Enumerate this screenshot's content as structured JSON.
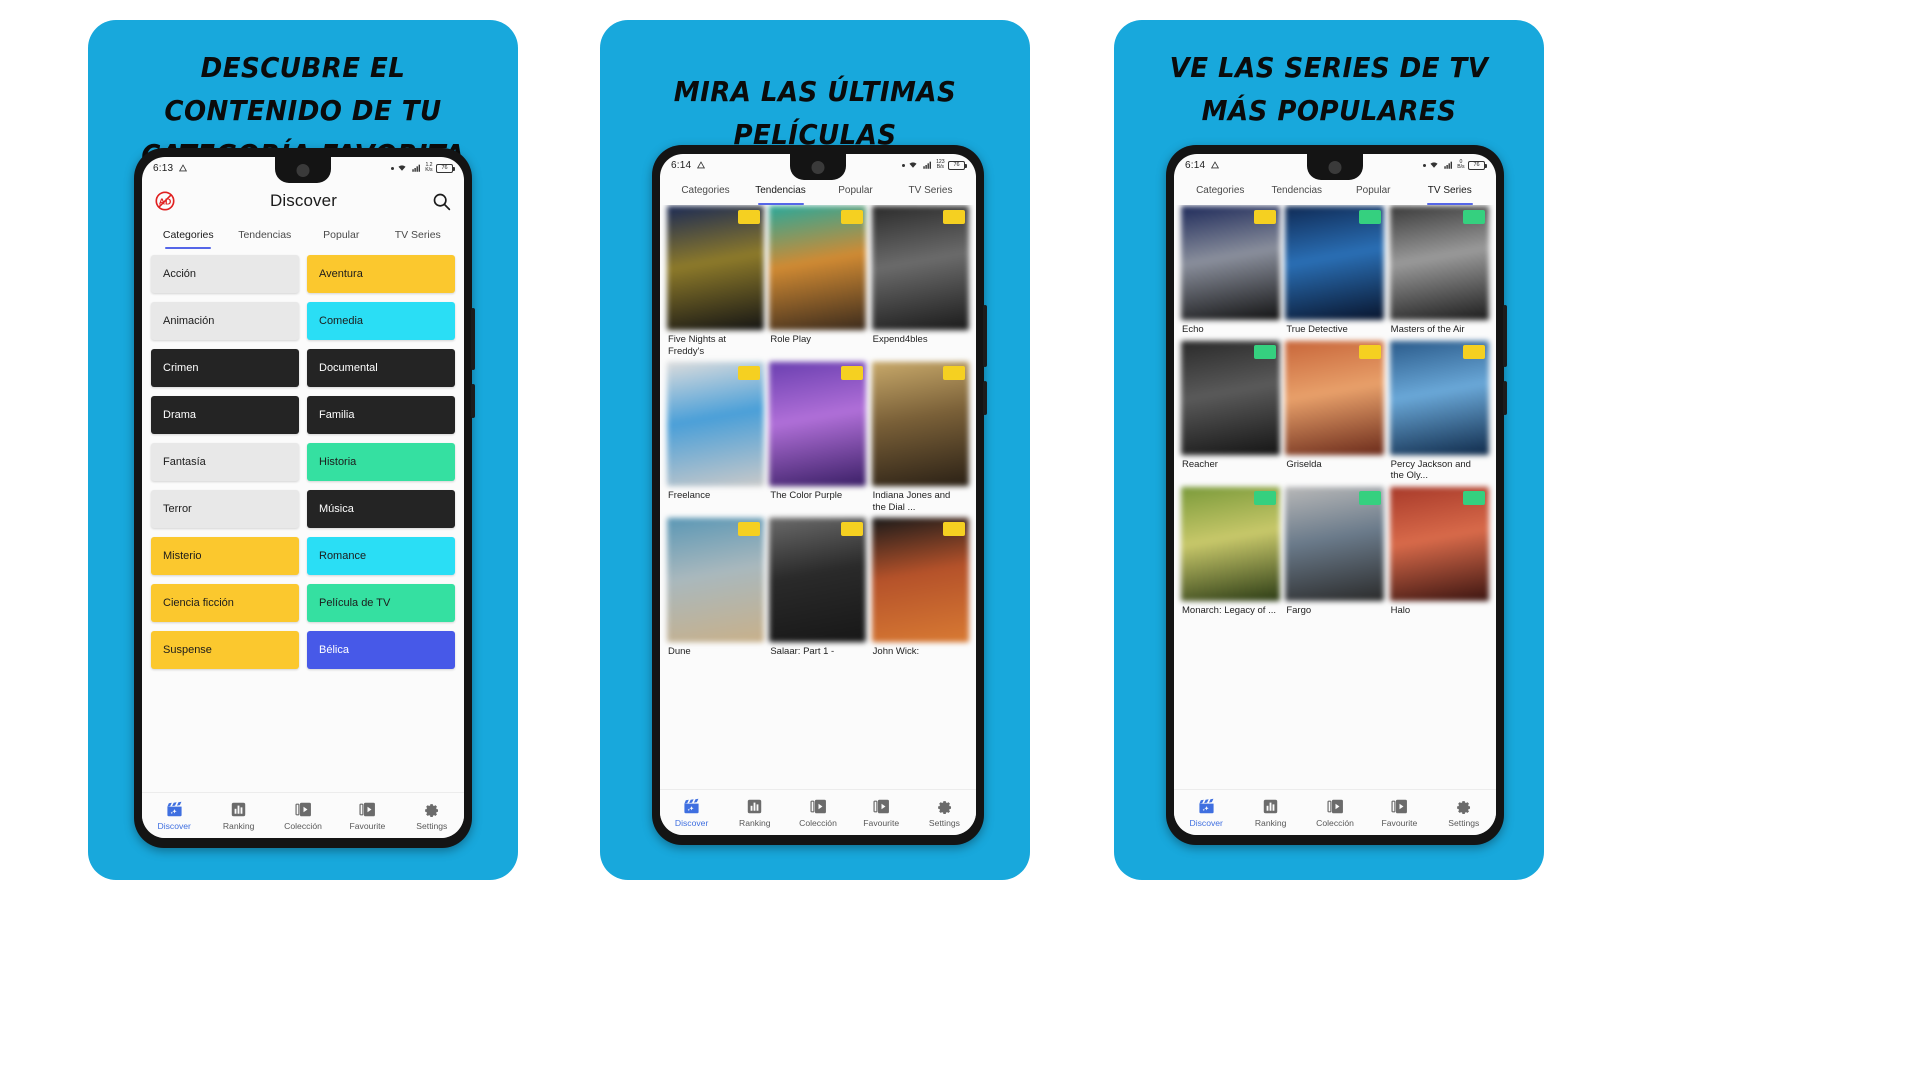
{
  "theme": {
    "slide_bg": "#18A8DC",
    "accent_blue": "#3f6fe0",
    "tab_underline": "#5566e8",
    "chip_gray": "#e8e8e8",
    "chip_yellow": "#fbc82e",
    "chip_cyan": "#2adef5",
    "chip_dark": "#242424",
    "chip_green": "#35e0a1",
    "chip_blue": "#4759e8",
    "badge_yellow": "#f5d021",
    "badge_green": "#35d07f",
    "headline_color": "#0b0b0b"
  },
  "slides": [
    {
      "headline": "Descubre el contenido de tu categoría favorita",
      "status": {
        "time": "6:13",
        "rate_top": "1.2",
        "rate_bottom": "K/s",
        "battery": "76"
      },
      "appbar": {
        "title": "Discover",
        "adblock_icon": "ad-block-icon",
        "search_icon": "search-icon"
      },
      "tabs": [
        {
          "label": "Categories",
          "active": true
        },
        {
          "label": "Tendencias",
          "active": false
        },
        {
          "label": "Popular",
          "active": false
        },
        {
          "label": "TV Series",
          "active": false
        }
      ],
      "categories": [
        {
          "label": "Acción",
          "color": "#e8e8e8",
          "text": "#1c1c1c"
        },
        {
          "label": "Aventura",
          "color": "#fbc82e",
          "text": "#1c1c1c"
        },
        {
          "label": "Animación",
          "color": "#e8e8e8",
          "text": "#1c1c1c"
        },
        {
          "label": "Comedia",
          "color": "#2adef5",
          "text": "#1c1c1c"
        },
        {
          "label": "Crimen",
          "color": "#242424",
          "text": "#ffffff"
        },
        {
          "label": "Documental",
          "color": "#242424",
          "text": "#ffffff"
        },
        {
          "label": "Drama",
          "color": "#242424",
          "text": "#ffffff"
        },
        {
          "label": "Familia",
          "color": "#242424",
          "text": "#ffffff"
        },
        {
          "label": "Fantasía",
          "color": "#e8e8e8",
          "text": "#1c1c1c"
        },
        {
          "label": "Historia",
          "color": "#35e0a1",
          "text": "#1c1c1c"
        },
        {
          "label": "Terror",
          "color": "#e8e8e8",
          "text": "#1c1c1c"
        },
        {
          "label": "Música",
          "color": "#242424",
          "text": "#ffffff"
        },
        {
          "label": "Misterio",
          "color": "#fbc82e",
          "text": "#1c1c1c"
        },
        {
          "label": "Romance",
          "color": "#2adef5",
          "text": "#1c1c1c"
        },
        {
          "label": "Ciencia ficción",
          "color": "#fbc82e",
          "text": "#1c1c1c"
        },
        {
          "label": "Película de TV",
          "color": "#35e0a1",
          "text": "#1c1c1c"
        },
        {
          "label": "Suspense",
          "color": "#fbc82e",
          "text": "#1c1c1c"
        },
        {
          "label": "Bélica",
          "color": "#4759e8",
          "text": "#ffffff"
        }
      ]
    },
    {
      "headline": "Mira las últimas películas",
      "status": {
        "time": "6:14",
        "rate_top": "123",
        "rate_bottom": "B/s",
        "battery": "76"
      },
      "tabs": [
        {
          "label": "Categories",
          "active": false
        },
        {
          "label": "Tendencias",
          "active": true
        },
        {
          "label": "Popular",
          "active": false
        },
        {
          "label": "TV Series",
          "active": false
        }
      ],
      "posters": [
        {
          "title": "Five Nights at Freddy's",
          "badge": "#f5d021",
          "c1": "#1b2a55",
          "c2": "#8d7a2a",
          "c3": "#141414"
        },
        {
          "title": "Role Play",
          "badge": "#f5d021",
          "c1": "#2aa89a",
          "c2": "#d08a33",
          "c3": "#3a2a1c"
        },
        {
          "title": "Expend4bles",
          "badge": "#f5d021",
          "c1": "#2b2b2b",
          "c2": "#6b6b6b",
          "c3": "#1a1a1a"
        },
        {
          "title": "Freelance",
          "badge": "#f5d021",
          "c1": "#dcdcdc",
          "c2": "#4a9fd8",
          "c3": "#c9c9c9"
        },
        {
          "title": "The Color Purple",
          "badge": "#f5d021",
          "c1": "#6a3fb0",
          "c2": "#b06fd8",
          "c3": "#3a1f66"
        },
        {
          "title": "Indiana Jones and the Dial ...",
          "badge": "#f5d021",
          "c1": "#c8a96a",
          "c2": "#7a6038",
          "c3": "#2a2015"
        },
        {
          "title": "Dune",
          "badge": "#f5d021",
          "c1": "#5a97b5",
          "c2": "#a9b8bd",
          "c3": "#c8b08a"
        },
        {
          "title": "Salaar: Part 1 -",
          "badge": "#f5d021",
          "c1": "#6a6a6a",
          "c2": "#2a2a2a",
          "c3": "#171717"
        },
        {
          "title": "John Wick:",
          "badge": "#f5d021",
          "c1": "#1a1a1a",
          "c2": "#b5522a",
          "c3": "#d87a33"
        }
      ]
    },
    {
      "headline": "Ve las series de TV más populares",
      "status": {
        "time": "6:14",
        "rate_top": "0",
        "rate_bottom": "B/s",
        "battery": "76"
      },
      "tabs": [
        {
          "label": "Categories",
          "active": false
        },
        {
          "label": "Tendencias",
          "active": false
        },
        {
          "label": "Popular",
          "active": false
        },
        {
          "label": "TV Series",
          "active": true
        }
      ],
      "posters": [
        {
          "title": "Echo",
          "badge": "#f5d021",
          "c1": "#1e2a5a",
          "c2": "#8a8f9c",
          "c3": "#121212"
        },
        {
          "title": "True Detective",
          "badge": "#35d07f",
          "c1": "#0f2a55",
          "c2": "#2a6fb5",
          "c3": "#08142c"
        },
        {
          "title": "Masters of the Air",
          "badge": "#35d07f",
          "c1": "#3a3a3a",
          "c2": "#9a9a9a",
          "c3": "#1c1c1c"
        },
        {
          "title": "Reacher",
          "badge": "#35d07f",
          "c1": "#2a2a2a",
          "c2": "#5a5a5a",
          "c3": "#141414"
        },
        {
          "title": "Griselda",
          "badge": "#f5d021",
          "c1": "#c8663a",
          "c2": "#e8a06a",
          "c3": "#6a2a1a"
        },
        {
          "title": "Percy Jackson and the Oly...",
          "badge": "#f5d021",
          "c1": "#2a5a8a",
          "c2": "#6aa8d8",
          "c3": "#0f2a4a"
        },
        {
          "title": "Monarch: Legacy of ...",
          "badge": "#35d07f",
          "c1": "#7a9a3a",
          "c2": "#c8c86a",
          "c3": "#2a3a14"
        },
        {
          "title": "Fargo",
          "badge": "#35d07f",
          "c1": "#b8b8b8",
          "c2": "#6a7a8a",
          "c3": "#2a2a2a"
        },
        {
          "title": "Halo",
          "badge": "#35d07f",
          "c1": "#a83a2a",
          "c2": "#d86a4a",
          "c3": "#3a1410"
        }
      ]
    }
  ],
  "bottom_nav": [
    {
      "label": "Discover",
      "icon": "clapperboard-icon",
      "active": true
    },
    {
      "label": "Ranking",
      "icon": "bar-chart-icon",
      "active": false
    },
    {
      "label": "Colección",
      "icon": "video-stack-icon",
      "active": false
    },
    {
      "label": "Favourite",
      "icon": "video-stack-icon",
      "active": false
    },
    {
      "label": "Settings",
      "icon": "gear-icon",
      "active": false
    }
  ]
}
